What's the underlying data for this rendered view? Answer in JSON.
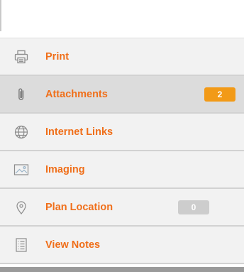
{
  "menu": {
    "items": [
      {
        "label": "Print",
        "icon": "printer-icon",
        "active": false
      },
      {
        "label": "Attachments",
        "icon": "paperclip-icon",
        "active": true,
        "badge": "2",
        "badge_color": "#f29a17"
      },
      {
        "label": "Internet Links",
        "icon": "globe-icon",
        "active": false
      },
      {
        "label": "Imaging",
        "icon": "image-icon",
        "active": false
      },
      {
        "label": "Plan Location",
        "icon": "map-pin-icon",
        "active": false,
        "badge": "0",
        "badge_color": "#cdcdcd"
      },
      {
        "label": "View Notes",
        "icon": "notes-icon",
        "active": false
      }
    ]
  },
  "colors": {
    "label": "#f06f1a",
    "icon": "#8c8c8c",
    "row_background": "#f2f2f2",
    "row_active_background": "#dcdcdc"
  }
}
